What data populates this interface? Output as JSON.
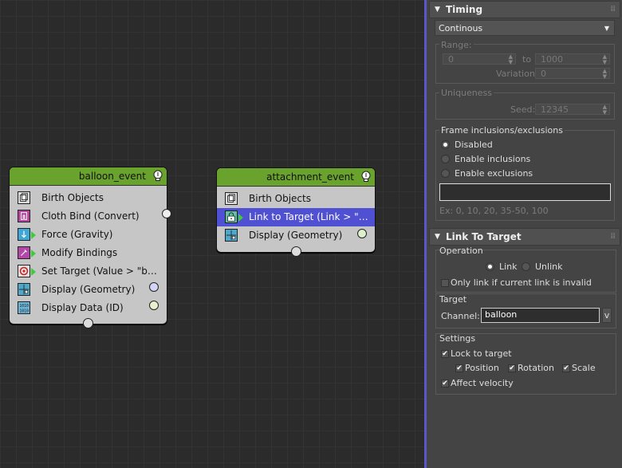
{
  "colors": {
    "node_header": "#6aa22e",
    "node_body": "#c6c6c6",
    "selection": "#5050d2",
    "panel_bg": "#444444",
    "panel_divider": "#5b57c6"
  },
  "nodes": {
    "balloon": {
      "title": "balloon_event",
      "icon": "lightbulb-icon",
      "operators": [
        {
          "label": "Birth Objects",
          "icon": "birth-objects-icon"
        },
        {
          "label": "Cloth Bind (Convert)",
          "icon": "cloth-bind-icon"
        },
        {
          "label": "Force (Gravity)",
          "icon": "force-icon"
        },
        {
          "label": "Modify Bindings",
          "icon": "modify-bindings-icon"
        },
        {
          "label": "Set Target (Value > \"balloo...",
          "icon": "set-target-icon"
        },
        {
          "label": "Display (Geometry)",
          "icon": "display-geometry-icon"
        },
        {
          "label": "Display Data (ID)",
          "icon": "display-data-icon"
        }
      ]
    },
    "attachment": {
      "title": "attachment_event",
      "icon": "lightbulb-icon",
      "operators": [
        {
          "label": "Birth Objects",
          "icon": "birth-objects-icon"
        },
        {
          "label": "Link to Target (Link > \"ball...",
          "icon": "link-target-icon"
        },
        {
          "label": "Display (Geometry)",
          "icon": "display-geometry-icon"
        }
      ]
    }
  },
  "panel": {
    "timing": {
      "title": "Timing",
      "mode": "Continous",
      "range_label": "Range:",
      "range_from": "0",
      "to_label": "to",
      "range_to": "1000",
      "variation_label": "Variation:",
      "variation": "0",
      "uniqueness_label": "Uniqueness",
      "seed_label": "Seed:",
      "seed": "12345",
      "frame_label": "Frame inclusions/exclusions",
      "options": [
        "Disabled",
        "Enable inclusions",
        "Enable exclusions"
      ],
      "selected_option": "Disabled",
      "frames_input": "",
      "example": "Ex: 0, 10, 20, 35-50, 100"
    },
    "link": {
      "title": "Link To Target",
      "operation_label": "Operation",
      "link_option": "Link",
      "unlink_option": "Unlink",
      "selected_operation": "Link",
      "only_link_label": "Only link if current link is invalid",
      "only_link_checked": false,
      "target_label": "Target",
      "channel_label": "Channel:",
      "channel_value": "balloon",
      "channel_button": "v",
      "settings_label": "Settings",
      "lock_label": "Lock to target",
      "lock_checked": true,
      "position_label": "Position",
      "position_checked": true,
      "rotation_label": "Rotation",
      "rotation_checked": true,
      "scale_label": "Scale",
      "scale_checked": true,
      "velocity_label": "Affect velocity",
      "velocity_checked": true
    }
  }
}
